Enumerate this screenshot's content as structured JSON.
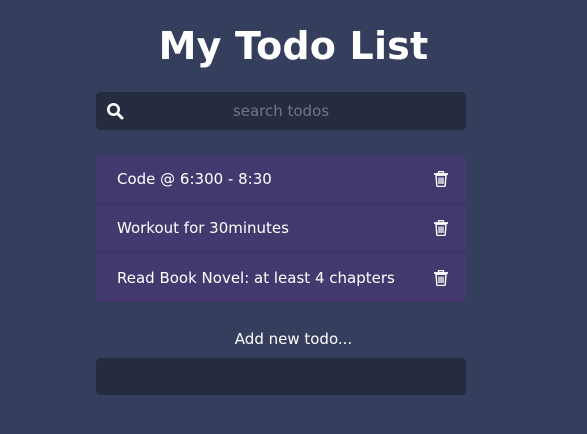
{
  "header": {
    "title": "My Todo List"
  },
  "search": {
    "placeholder": "search todos",
    "value": "",
    "icon": "search-icon"
  },
  "todos": [
    {
      "text": "Code @ 6:300 - 8:30",
      "icon": "trash-icon"
    },
    {
      "text": "Workout for 30minutes",
      "icon": "trash-icon"
    },
    {
      "text": "Read Book Novel: at least 4 chapters",
      "icon": "trash-icon"
    }
  ],
  "add_todo": {
    "label": "Add new todo...",
    "value": ""
  },
  "colors": {
    "background": "#353f5d",
    "input_background": "#262c40",
    "todo_background": "#44396e",
    "text": "#ffffff",
    "placeholder": "#6f758a"
  }
}
